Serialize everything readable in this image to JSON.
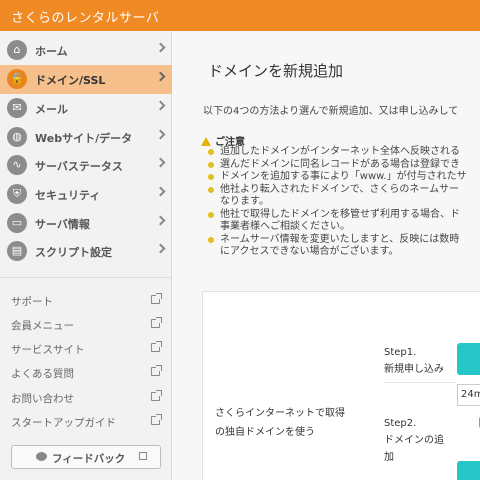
{
  "app": {
    "title": "さくらのレンタルサーバ"
  },
  "sidebar": {
    "nav": [
      {
        "label": "ホーム",
        "icon": "home-icon",
        "glyph": "⌂",
        "active": false
      },
      {
        "label": "ドメイン/SSL",
        "icon": "lock-icon",
        "glyph": "🔒",
        "active": true
      },
      {
        "label": "メール",
        "icon": "mail-icon",
        "glyph": "✉",
        "active": false
      },
      {
        "label": "Webサイト/データ",
        "icon": "globe-icon",
        "glyph": "◍",
        "active": false
      },
      {
        "label": "サーバステータス",
        "icon": "chart-icon",
        "glyph": "∿",
        "active": false
      },
      {
        "label": "セキュリティ",
        "icon": "shield-icon",
        "glyph": "⛨",
        "active": false
      },
      {
        "label": "サーバ情報",
        "icon": "server-icon",
        "glyph": "▭",
        "active": false
      },
      {
        "label": "スクリプト設定",
        "icon": "script-icon",
        "glyph": "▤",
        "active": false
      }
    ],
    "links": [
      {
        "label": "サポート"
      },
      {
        "label": "会員メニュー"
      },
      {
        "label": "サービスサイト"
      },
      {
        "label": "よくある質問"
      },
      {
        "label": "お問い合わせ"
      },
      {
        "label": "スタートアップガイド"
      }
    ],
    "feedback_label": "フィードバック"
  },
  "main": {
    "title": "ドメインを新規追加",
    "intro": "以下の4つの方法より選んで新規追加、又は申し込みして",
    "notice_heading": "ご注意",
    "notes": [
      {
        "line1": "追加したドメインがインターネット全体へ反映される",
        "line2": ""
      },
      {
        "line1": "選んだドメインに同名レコードがある場合は登録でき",
        "line2": ""
      },
      {
        "line1": "ドメインを追加する事により「www.」が付与されたサ",
        "line2": ""
      },
      {
        "line1": "他社より転入されたドメインで、さくらのネームサー",
        "line2": "なります。"
      },
      {
        "line1": "他社で取得したドメインを移管せず利用する場合、ド",
        "line2": "事業者様へご相談ください。"
      },
      {
        "line1": "ネームサーバ情報を変更いたしますと、反映には数時",
        "line2": "にアクセスできない場合がございます。"
      }
    ],
    "card": {
      "desc_line1": "さくらインターネットで取得",
      "desc_line2": "の独自ドメインを使う",
      "step1_title": "Step1.",
      "step1_text": "新規申し込み",
      "step2_title": "Step2.",
      "step2_line1": "ドメインの追",
      "step2_line2": "加",
      "term_value": "24m"
    }
  }
}
